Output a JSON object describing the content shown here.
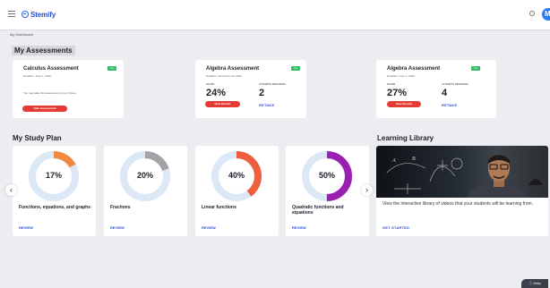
{
  "header": {
    "brand": "Stemify",
    "avatar_initial": "M",
    "breadcrumb": "My Dashboard"
  },
  "sections": {
    "assessments": "My Assessments",
    "study_plan": "My Study Plan",
    "library": "Learning Library"
  },
  "assessments": [
    {
      "title": "Calculus Assessment",
      "deadline": "Deadline: June 1, 2020",
      "tag": "Live",
      "info": "You may take this assessment up to 3 times.",
      "button": "Take Assessment"
    },
    {
      "title": "Algebra Assessment",
      "deadline": "Deadline: November 20, 2020",
      "tag": "Live",
      "score_label": "SCORE",
      "score": "24%",
      "attempts_label": "ATTEMPTS REMAINING",
      "attempts": "2",
      "button": "View Results",
      "link": "RETAKE"
    },
    {
      "title": "Algebra Assessment",
      "deadline": "Deadline: June 1, 2020",
      "tag": "Live",
      "score_label": "SCORE",
      "score": "27%",
      "attempts_label": "ATTEMPTS REMAINING",
      "attempts": "4",
      "button": "View Results",
      "link": "RETAKE"
    }
  ],
  "study_plan": [
    {
      "percent": "17%",
      "progress": 0.17,
      "color": "#f08a3e",
      "topic": "Functions, equations, and graphs",
      "link": "REVIEW"
    },
    {
      "percent": "20%",
      "progress": 0.2,
      "color": "#a3a3a8",
      "topic": "Fractions",
      "link": "REVIEW"
    },
    {
      "percent": "40%",
      "progress": 0.4,
      "color": "#ef5f3f",
      "topic": "Linear functions",
      "link": "REVIEW"
    },
    {
      "percent": "50%",
      "progress": 0.5,
      "color": "#9b1fb0",
      "topic": "Quadratic functions and equations",
      "link": "REVIEW"
    }
  ],
  "ring_track_color": "#dde8f6",
  "library": {
    "description": "View the interactive library of videos that your students will be learning from.",
    "link": "GET STARTED"
  },
  "carousel": {
    "prev": "‹",
    "next": "›"
  },
  "help_label": "Help",
  "colors": {
    "brand": "#2a4ed0",
    "danger": "#e53b36",
    "live": "#2fbf65"
  }
}
